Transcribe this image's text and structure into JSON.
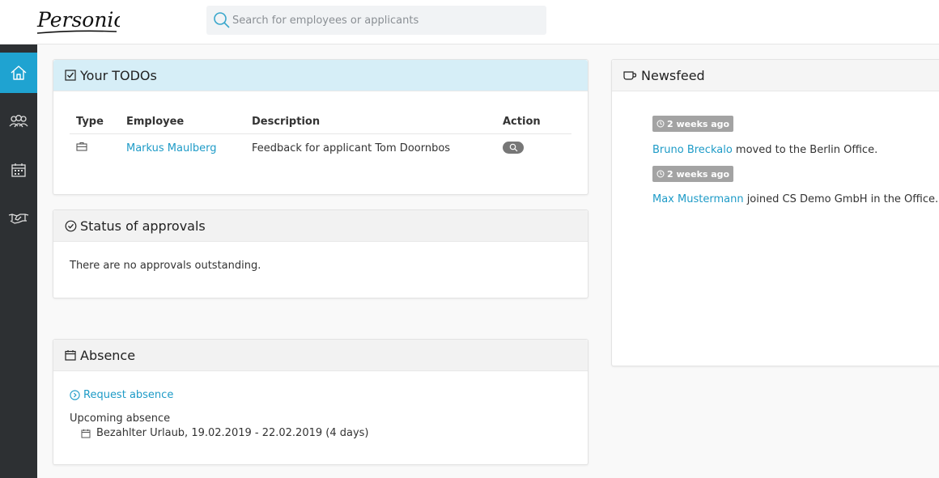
{
  "brand": {
    "logo_text": "Personio"
  },
  "search": {
    "placeholder": "Search for employees or applicants"
  },
  "sidebar": {
    "items": [
      {
        "name": "home",
        "icon": "home-icon",
        "active": true
      },
      {
        "name": "employees",
        "icon": "people-icon",
        "active": false
      },
      {
        "name": "calendar",
        "icon": "calendar-icon",
        "active": false
      },
      {
        "name": "recruiting",
        "icon": "handshake-icon",
        "active": false
      }
    ]
  },
  "todos": {
    "title": "Your TODOs",
    "columns": [
      "Type",
      "Employee",
      "Description",
      "Action"
    ],
    "rows": [
      {
        "type_icon": "briefcase-icon",
        "employee": "Markus Maulberg",
        "description": "Feedback for applicant Tom Doornbos",
        "action_icon": "search-icon"
      }
    ]
  },
  "approvals": {
    "title": "Status of approvals",
    "message": "There are no approvals outstanding."
  },
  "absence": {
    "title": "Absence",
    "request_label": "Request absence",
    "upcoming_label": "Upcoming absence",
    "entries": [
      "Bezahlter Urlaub, 19.02.2019 - 22.02.2019 (4 days)"
    ]
  },
  "newsfeed": {
    "title": "Newsfeed",
    "items": [
      {
        "time": "2 weeks ago",
        "person": "Bruno Breckalo",
        "text": " moved to the Berlin Office."
      },
      {
        "time": "2 weeks ago",
        "person": "Max Mustermann",
        "text": " joined CS Demo GmbH in the Office."
      }
    ]
  },
  "colors": {
    "accent": "#1fa3d1",
    "link": "#1e9bc7",
    "sidebar": "#2d3033",
    "todo_header": "#d6eef7"
  }
}
